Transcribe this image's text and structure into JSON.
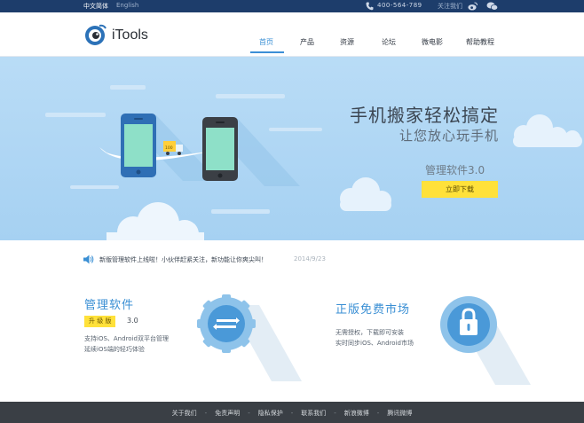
{
  "topbar": {
    "lang_cn": "中文简体",
    "lang_en": "English",
    "phone": "400-564-789",
    "follow": "关注我们"
  },
  "header": {
    "logo_text": "iTools",
    "nav": [
      "首页",
      "产品",
      "资源",
      "论坛",
      "微电影",
      "帮助教程"
    ],
    "active_index": 0
  },
  "hero": {
    "title": "手机搬家轻松搞定",
    "subtitle": "让您放心玩手机",
    "version": "管理软件3.0",
    "button": "立即下载",
    "truck_label": "100"
  },
  "news": {
    "text": "新版管理软件上线啦！小伙伴赶紧关注，新功能让你爽尖叫！",
    "date": "2014/9/23"
  },
  "features": {
    "f1": {
      "title": "管理软件",
      "badge": "升 级 版",
      "version": "3.0",
      "desc1": "支持iOS、Android双平台管理",
      "desc2": "延续iOS端的轻巧体验"
    },
    "f2": {
      "title": "正版免费市场",
      "desc1": "无需授权，下载即可安装",
      "desc2": "实时同步iOS、Android市场"
    }
  },
  "footer": {
    "links": [
      "关于我们",
      "免责声明",
      "隐私保护",
      "联系我们",
      "新浪微博",
      "腾讯微博"
    ]
  },
  "colors": {
    "topbar": "#1d3d6b",
    "accent": "#3a8fd4",
    "button": "#ffe13a",
    "footer": "#3a3f45"
  }
}
